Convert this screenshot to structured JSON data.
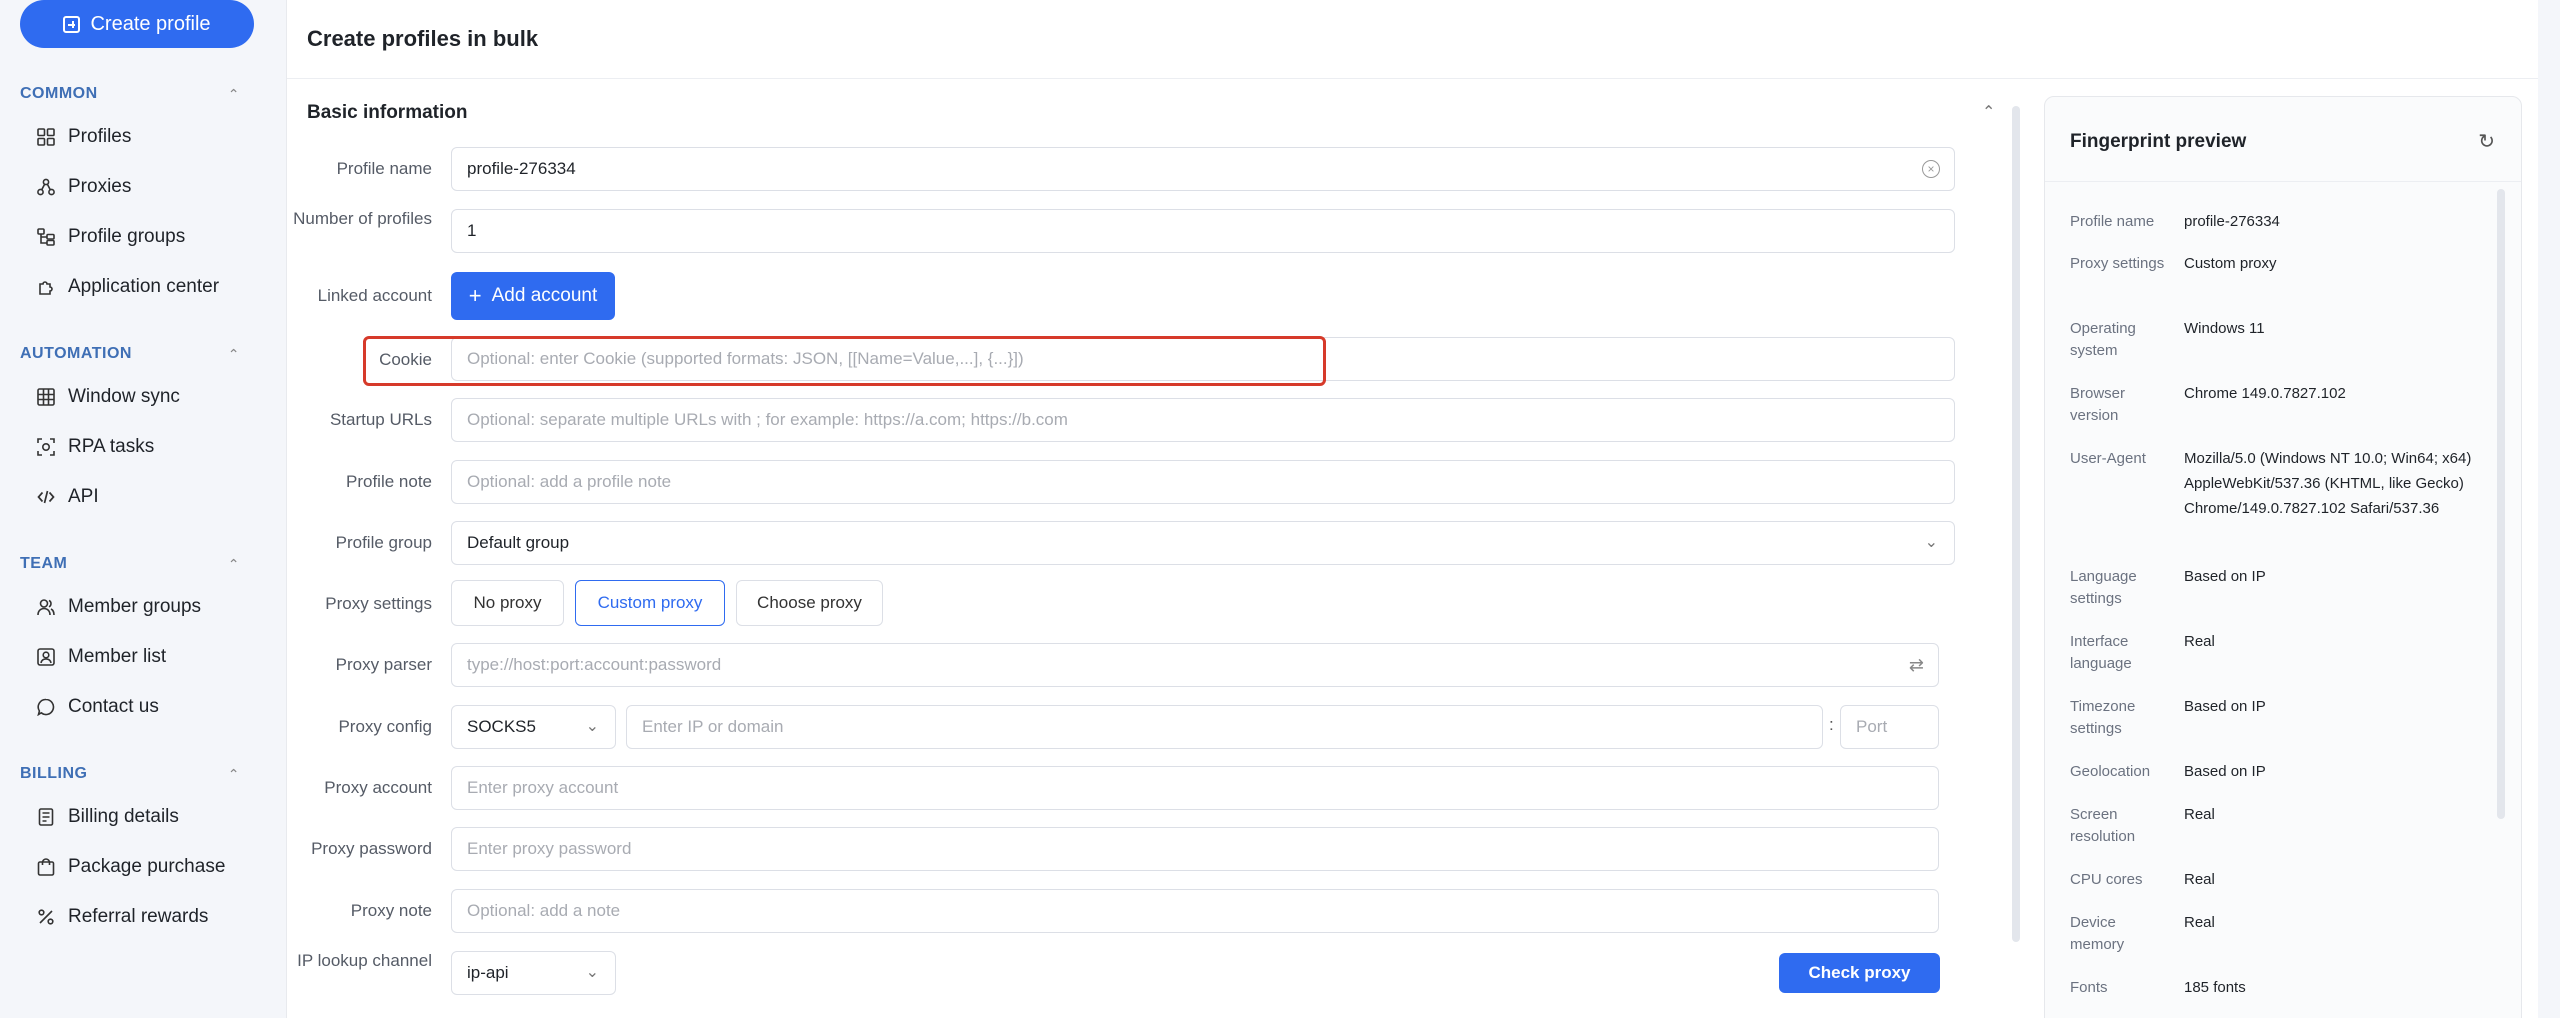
{
  "sidebar": {
    "create_label": "Create profile",
    "sections": {
      "common": "COMMON",
      "automation": "AUTOMATION",
      "team": "TEAM",
      "billing": "BILLING"
    },
    "items": {
      "profiles": "Profiles",
      "proxies": "Proxies",
      "profile_groups": "Profile groups",
      "application_center": "Application center",
      "window_sync": "Window sync",
      "rpa_tasks": "RPA tasks",
      "api": "API",
      "member_groups": "Member groups",
      "member_list": "Member list",
      "contact_us": "Contact us",
      "billing_details": "Billing details",
      "package_purchase": "Package purchase",
      "referral_rewards": "Referral rewards"
    },
    "caret": "^"
  },
  "main": {
    "title": "Create profiles in bulk",
    "section_title": "Basic information",
    "labels": {
      "profile_name": "Profile name",
      "number_of_profiles": "Number of profiles",
      "linked_account": "Linked account",
      "cookie": "Cookie",
      "startup_urls": "Startup URLs",
      "profile_note": "Profile note",
      "profile_group": "Profile group",
      "proxy_settings": "Proxy settings",
      "proxy_parser": "Proxy parser",
      "proxy_config": "Proxy config",
      "proxy_account": "Proxy account",
      "proxy_password": "Proxy password",
      "proxy_note": "Proxy note",
      "ip_lookup_channel": "IP lookup channel"
    },
    "values": {
      "profile_name": "profile-276334",
      "number_of_profiles": "1",
      "profile_group": "Default group",
      "proxy_type": "SOCKS5",
      "ip_lookup": "ip-api"
    },
    "placeholders": {
      "cookie": "Optional: enter Cookie (supported formats: JSON, [[Name=Value,...], {...}])",
      "startup_urls": "Optional: separate multiple URLs with ; for example: https://a.com; https://b.com",
      "profile_note": "Optional: add a profile note",
      "proxy_parser": "type://host:port:account:password",
      "proxy_host": "Enter IP or domain",
      "proxy_port": "Port",
      "proxy_account": "Enter proxy account",
      "proxy_password": "Enter proxy password",
      "proxy_note": "Optional: add a note"
    },
    "buttons": {
      "add_account": "Add account",
      "no_proxy": "No proxy",
      "custom_proxy": "Custom proxy",
      "choose_proxy": "Choose proxy",
      "check_proxy": "Check proxy"
    },
    "colon": ":"
  },
  "fingerprint": {
    "title": "Fingerprint preview",
    "rows": [
      {
        "key": "Profile name",
        "value": "profile-276334"
      },
      {
        "key": "Proxy settings",
        "value": "Custom proxy"
      },
      {
        "key": "Operating system",
        "value": "Windows 11"
      },
      {
        "key": "Browser version",
        "value": "Chrome 149.0.7827.102"
      },
      {
        "key": "User-Agent",
        "value": "Mozilla/5.0 (Windows NT 10.0; Win64; x64) AppleWebKit/537.36 (KHTML, like Gecko) Chrome/149.0.7827.102 Safari/537.36"
      },
      {
        "key": "Language settings",
        "value": "Based on IP"
      },
      {
        "key": "Interface language",
        "value": "Real"
      },
      {
        "key": "Timezone settings",
        "value": "Based on IP"
      },
      {
        "key": "Geolocation",
        "value": "Based on IP"
      },
      {
        "key": "Screen resolution",
        "value": "Real"
      },
      {
        "key": "CPU cores",
        "value": "Real"
      },
      {
        "key": "Device memory",
        "value": "Real"
      },
      {
        "key": "Fonts",
        "value": "185 fonts"
      }
    ]
  }
}
